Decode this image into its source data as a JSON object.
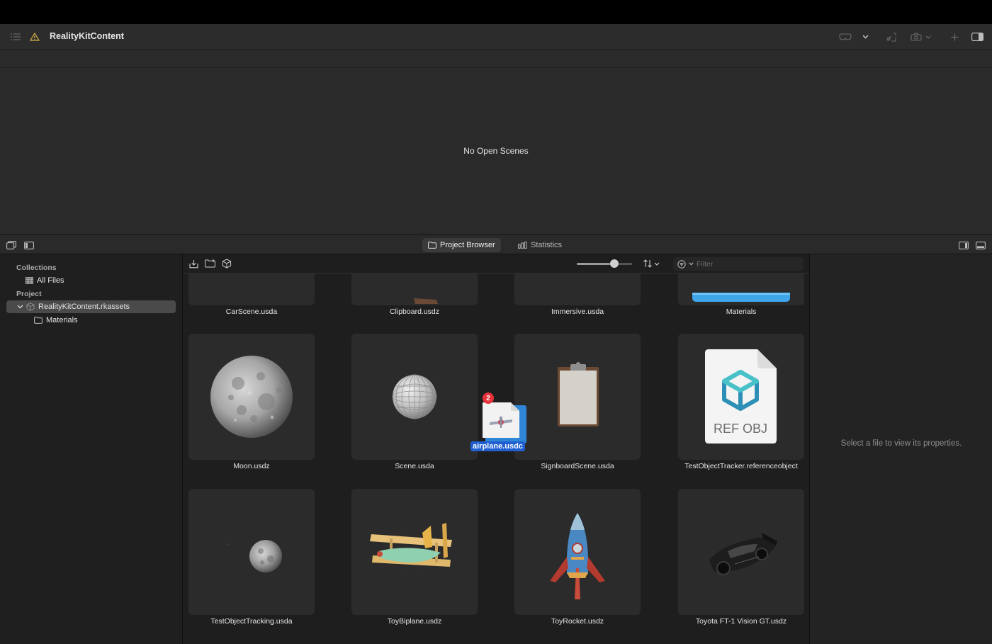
{
  "window": {
    "title": "RealityKitContent"
  },
  "viewport": {
    "empty_message": "No Open Scenes"
  },
  "bottom_tabs": [
    {
      "label": "Project Browser",
      "active": true
    },
    {
      "label": "Statistics",
      "active": false
    }
  ],
  "sidebar": {
    "collections_header": "Collections",
    "all_files": "All Files",
    "project_header": "Project",
    "rkassets": "RealityKitContent.rkassets",
    "materials_folder": "Materials"
  },
  "browser": {
    "filter_placeholder": "Filter",
    "thumbnail_size_fraction": 0.68,
    "rows": [
      [
        "CarScene.usda",
        "Clipboard.usdz",
        "Immersive.usda",
        "Materials"
      ],
      [
        "Moon.usdz",
        "Scene.usda",
        "SignboardScene.usda",
        "TestObjectTracker.referenceobject"
      ],
      [
        "TestObjectTracking.usda",
        "ToyBiplane.usdz",
        "ToyRocket.usdz",
        "Toyota FT-1 Vision GT.usdz"
      ]
    ],
    "ref_obj_label": "REF OBJ"
  },
  "drag": {
    "filename": "airplane.usdc",
    "count": "2"
  },
  "inspector": {
    "hint": "Select a file to view its properties."
  },
  "colors": {
    "accent_blue": "#1f5fd1",
    "badge_red": "#e8333a",
    "warning_yellow": "#d6b34a"
  }
}
